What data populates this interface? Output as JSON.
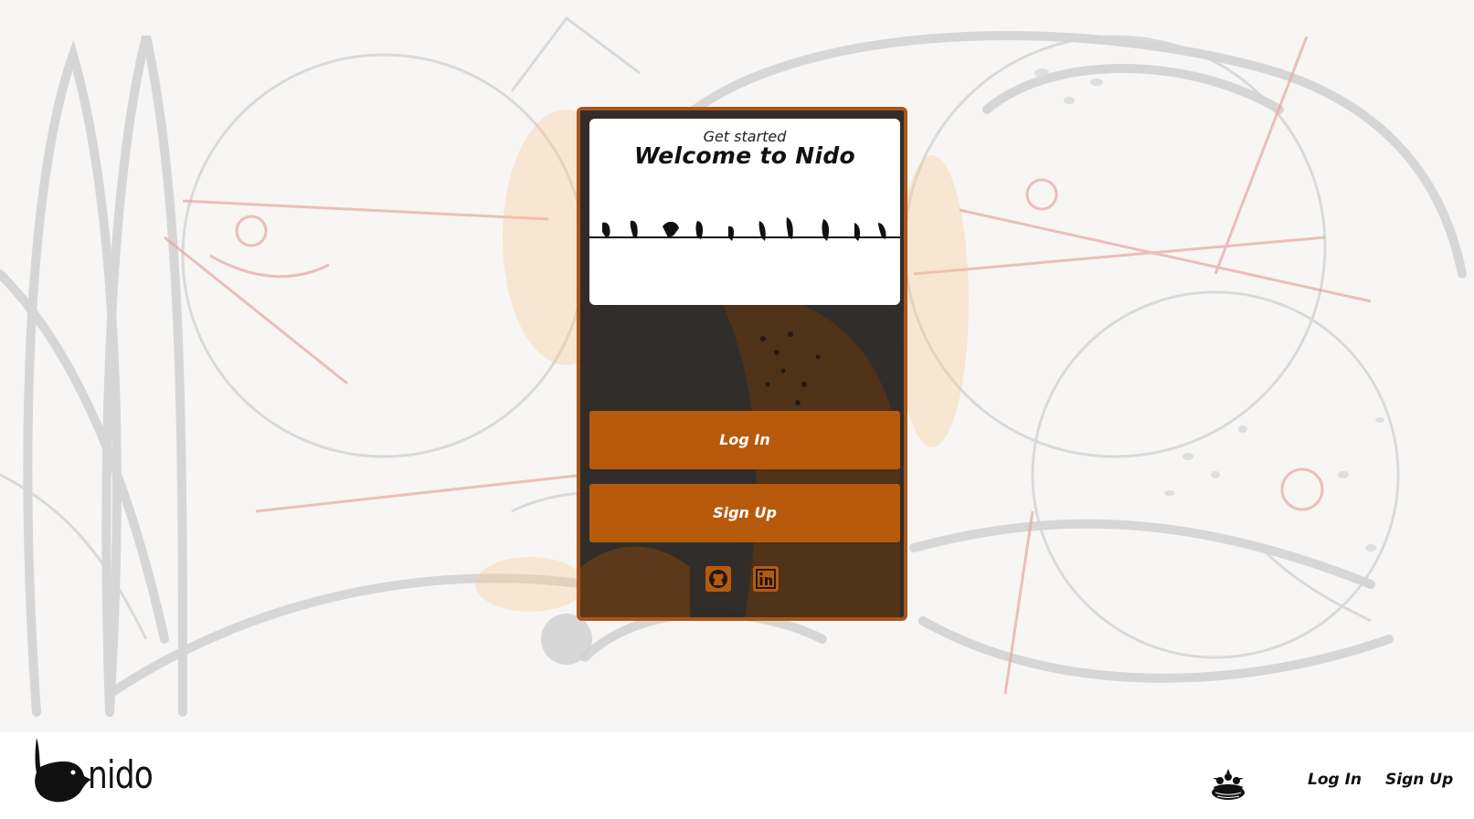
{
  "card": {
    "eyebrow": "Get started",
    "headline": "Welcome to Nido",
    "login_label": "Log In",
    "signup_label": "Sign Up",
    "socials": [
      {
        "icon": "github-icon"
      },
      {
        "icon": "linkedin-icon"
      }
    ]
  },
  "footer": {
    "brand": "nido",
    "nav": {
      "login_label": "Log In",
      "signup_label": "Sign Up"
    }
  },
  "colors": {
    "accent": "#b85a0b",
    "card_border": "#a8561a",
    "card_bg": "#24201e",
    "sketch_line": "#c9c9c9",
    "sketch_red": "#e8a6a0"
  }
}
